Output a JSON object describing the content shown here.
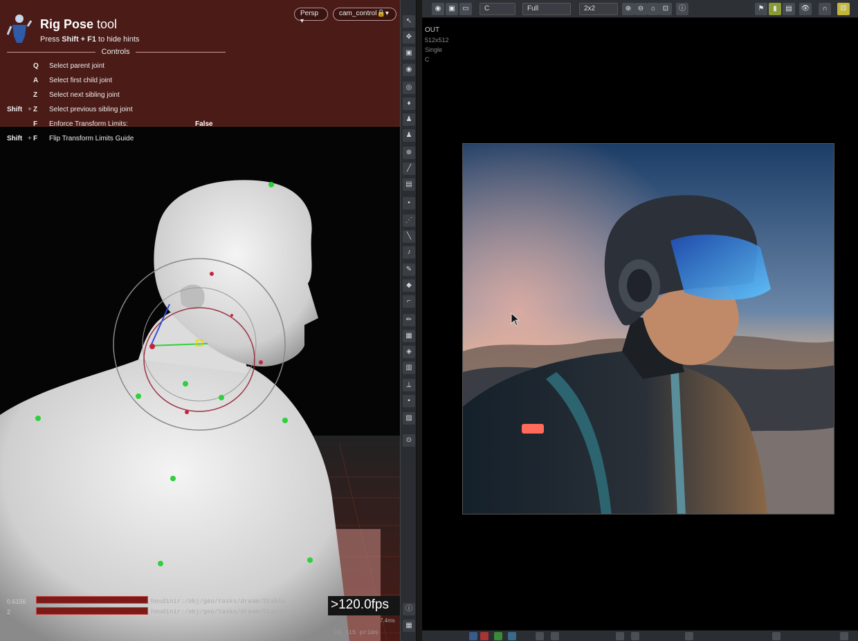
{
  "viewport": {
    "tool_name_bold": "Rig Pose",
    "tool_name_rest": " tool",
    "hint_prefix": "Press ",
    "hint_keys": "Shift + F1",
    "hint_suffix": " to hide hints",
    "controls_title": "Controls",
    "camera_menu": "Persp ▾",
    "cam_control_menu": "cam_control🔒▾",
    "hotkeys": [
      {
        "mod": "",
        "key": "Q",
        "desc": "Select parent joint",
        "val": ""
      },
      {
        "mod": "",
        "key": "A",
        "desc": "Select first child joint",
        "val": ""
      },
      {
        "mod": "",
        "key": "Z",
        "desc": "Select next sibling joint",
        "val": ""
      },
      {
        "mod": "Shift",
        "key": "Z",
        "desc": "Select previous sibling joint",
        "val": ""
      },
      {
        "mod": "",
        "key": "F",
        "desc": "Enforce Transform Limits:",
        "val": "False"
      },
      {
        "mod": "Shift",
        "key": "F",
        "desc": "Flip Transform Limits Guide",
        "val": ""
      }
    ],
    "perf": {
      "val1": "0.6156",
      "val2": "2",
      "path1": "houdinir:/obj/geo/tasks/dream/Stable",
      "path2": "houdinir:/obj/geo/tasks/dream/Stable",
      "fps": ">120.0fps",
      "ms": "7.4ms",
      "count": "20,115  prims"
    }
  },
  "render": {
    "toolbar": {
      "channel": "C",
      "mode": "Full",
      "layout": "2x2"
    },
    "output": {
      "name": "OUT",
      "resolution": "512x512",
      "mode": "Single",
      "channel": "C"
    }
  },
  "shelf_icons": [
    "select",
    "move",
    "rotate",
    "scale",
    "handle",
    "view",
    "light",
    "camera",
    "pose",
    "capture",
    "paint",
    "bone",
    "muscle",
    "sculpt",
    "edit",
    "brush",
    "grid",
    "snap",
    "weights",
    "constraint",
    "stack",
    "record",
    "link",
    "render",
    "info"
  ],
  "colors": {
    "hint_bg": "#4a1b17",
    "accent_red": "#c44",
    "gizmo_green": "#2ed03c",
    "gizmo_red": "#c8233b"
  }
}
